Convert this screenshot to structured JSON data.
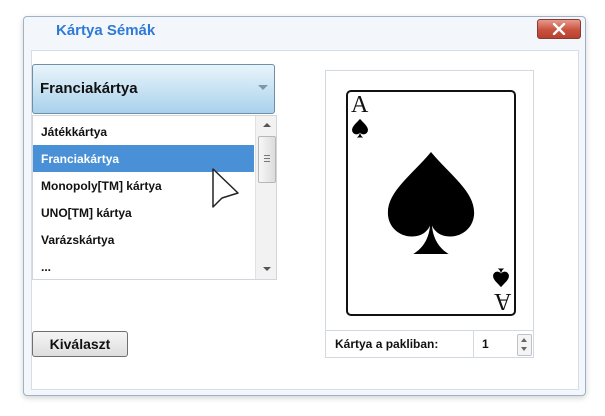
{
  "window": {
    "title": "Kártya Sémák"
  },
  "dropdown": {
    "selected": "Franciakártya"
  },
  "list": {
    "items": [
      {
        "label": "Játékkártya",
        "selected": false
      },
      {
        "label": "Franciakártya",
        "selected": true
      },
      {
        "label": "Monopoly[TM] kártya",
        "selected": false
      },
      {
        "label": "UNO[TM] kártya",
        "selected": false
      },
      {
        "label": "Varázskártya",
        "selected": false
      },
      {
        "label": "...",
        "selected": false
      }
    ]
  },
  "buttons": {
    "select_label": "Kiválaszt"
  },
  "preview": {
    "rank": "A",
    "suit_icon": "spade-icon"
  },
  "deck_count": {
    "label": "Kártya a pakliban:",
    "value": "1"
  },
  "colors": {
    "title": "#2f7ad6",
    "selection": "#4a90d6",
    "close": "#c9523f"
  }
}
